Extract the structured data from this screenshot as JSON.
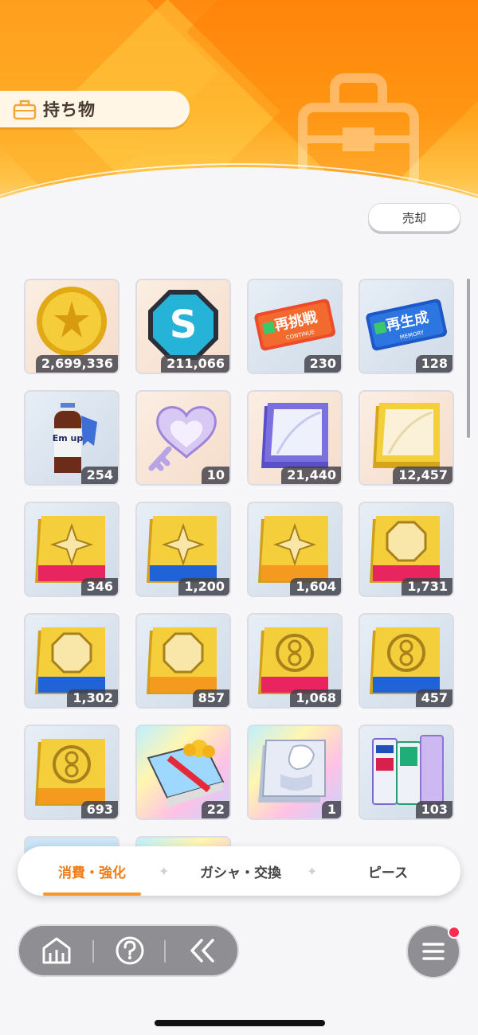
{
  "header": {
    "title": "持ち物",
    "sell_label": "売却"
  },
  "items": [
    {
      "qty": "2,699,336",
      "icon": "gold-coin-icon"
    },
    {
      "qty": "211,066",
      "icon": "s-badge-icon"
    },
    {
      "qty": "230",
      "icon": "continue-ticket-icon",
      "label": "再挑戦",
      "sub": "CONTINUE"
    },
    {
      "qty": "128",
      "icon": "memory-ticket-icon",
      "label": "再生成",
      "sub": "MEMORY"
    },
    {
      "qty": "254",
      "icon": "energy-drink-icon",
      "label": "Em up"
    },
    {
      "qty": "10",
      "icon": "heart-key-icon"
    },
    {
      "qty": "21,440",
      "icon": "purple-book-icon"
    },
    {
      "qty": "12,457",
      "icon": "gold-book-icon"
    },
    {
      "qty": "346",
      "icon": "sparkle-book-pink-icon"
    },
    {
      "qty": "1,200",
      "icon": "sparkle-book-blue-icon"
    },
    {
      "qty": "1,604",
      "icon": "sparkle-book-orange-icon"
    },
    {
      "qty": "1,731",
      "icon": "emblem-book-pink-icon"
    },
    {
      "qty": "1,302",
      "icon": "emblem-book-blue-icon"
    },
    {
      "qty": "857",
      "icon": "emblem-book-orange-icon"
    },
    {
      "qty": "1,068",
      "icon": "swirl-book-pink-icon"
    },
    {
      "qty": "457",
      "icon": "swirl-book-blue-icon"
    },
    {
      "qty": "693",
      "icon": "swirl-book-orange-icon"
    },
    {
      "qty": "22",
      "icon": "gift-book-icon"
    },
    {
      "qty": "1",
      "icon": "silver-book-icon"
    },
    {
      "qty": "103",
      "icon": "book-stack-icon"
    }
  ],
  "tabs": [
    {
      "label": "消費・強化"
    },
    {
      "label": "ガシャ・交換"
    },
    {
      "label": "ピース"
    }
  ],
  "tab_separator": "✦",
  "colors": {
    "accent": "#f07d1b",
    "header": "#ff9a1a",
    "qty_bg": "#404048"
  }
}
